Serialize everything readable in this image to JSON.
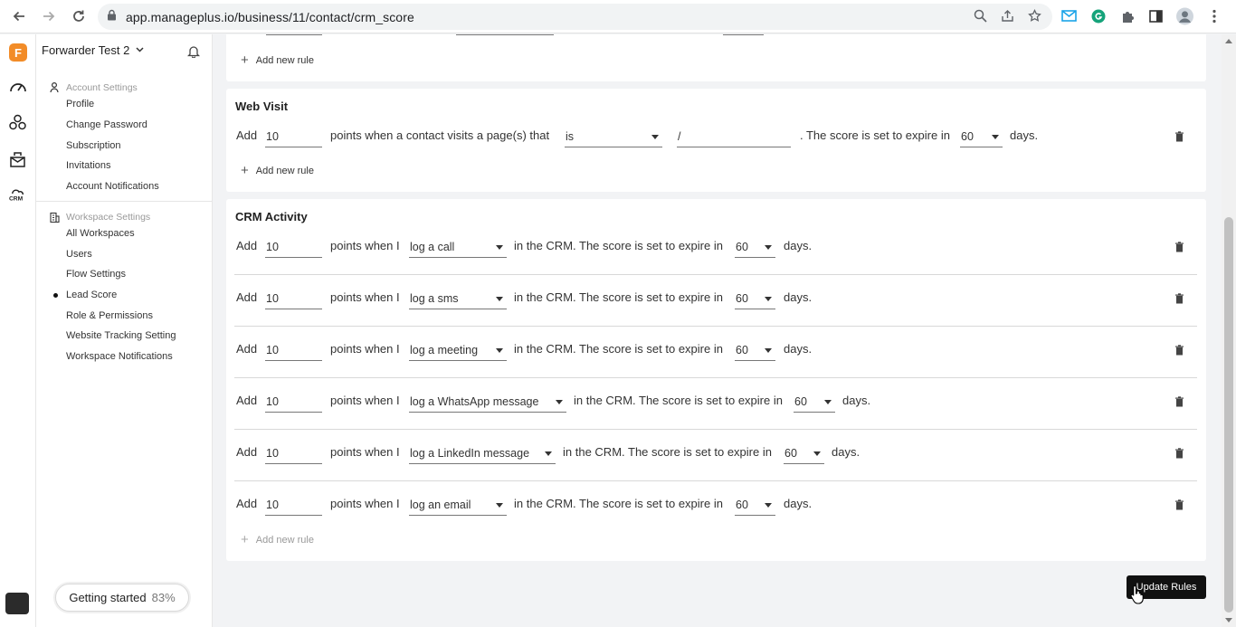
{
  "browser": {
    "url": "app.manageplus.io/business/11/contact/crm_score"
  },
  "brand": {
    "logo_letter": "F",
    "name": "Forwarder Test 2"
  },
  "sidebar": {
    "account_settings": {
      "heading": "Account Settings",
      "items": [
        "Profile",
        "Change Password",
        "Subscription",
        "Invitations",
        "Account Notifications"
      ]
    },
    "workspace_settings": {
      "heading": "Workspace Settings",
      "items": [
        "All Workspaces",
        "Users",
        "Flow Settings",
        "Lead Score",
        "Role & Permissions",
        "Website Tracking Setting",
        "Workspace Notifications"
      ],
      "active": "Lead Score"
    }
  },
  "getting_started": {
    "label": "Getting started",
    "percent": "83%"
  },
  "top_card": {
    "add_rule": "Add new rule"
  },
  "web_visit": {
    "title": "Web Visit",
    "row": {
      "add": "Add",
      "points": "10",
      "mid": "points when a contact visits a page(s) that",
      "operator": "is",
      "page": "/",
      "expire_text": ". The score is set to expire in",
      "days_value": "60",
      "days": "days."
    },
    "add_rule": "Add new rule"
  },
  "crm_activity": {
    "title": "CRM Activity",
    "add": "Add",
    "points_when": "points when I",
    "expire_text": "in the CRM. The score is set to expire in",
    "days": "days.",
    "rows": [
      {
        "points": "10",
        "activity": "log a call",
        "days_value": "60"
      },
      {
        "points": "10",
        "activity": "log a sms",
        "days_value": "60"
      },
      {
        "points": "10",
        "activity": "log a meeting",
        "days_value": "60"
      },
      {
        "points": "10",
        "activity": "log a WhatsApp message",
        "days_value": "60"
      },
      {
        "points": "10",
        "activity": "log a LinkedIn message",
        "days_value": "60"
      },
      {
        "points": "10",
        "activity": "log an email",
        "days_value": "60"
      }
    ],
    "add_rule": "Add new rule"
  },
  "update_button": "Update Rules"
}
